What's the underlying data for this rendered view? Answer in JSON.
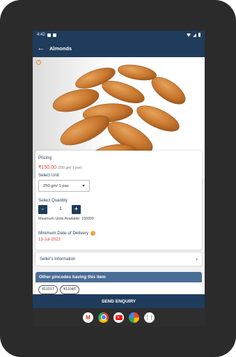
{
  "status": {
    "time": "4:42"
  },
  "appbar": {
    "title": "Almonds"
  },
  "pricing": {
    "label": "Pricing",
    "price": "₹150.00",
    "price_sub": "(250 gm/ 1 pav)"
  },
  "unit": {
    "label": "Select Unit",
    "value": "250 gm/ 1 pav"
  },
  "quantity": {
    "label": "Select Quantity",
    "value": "1",
    "minus": "-",
    "plus": "+",
    "max_units": "Maximum Units Available: 150000"
  },
  "delivery": {
    "label": "Minimum Date of Delivery",
    "date": "13-Jul-2023"
  },
  "seller": {
    "label": "Seller's Information"
  },
  "pincodes": {
    "title": "Other pincodes having this item",
    "items": [
      "411017",
      "411045"
    ]
  },
  "actions": {
    "send": "SEND ENQUIRY"
  },
  "colors": {
    "primary": "#1f3c5c",
    "accent": "#e53935"
  }
}
